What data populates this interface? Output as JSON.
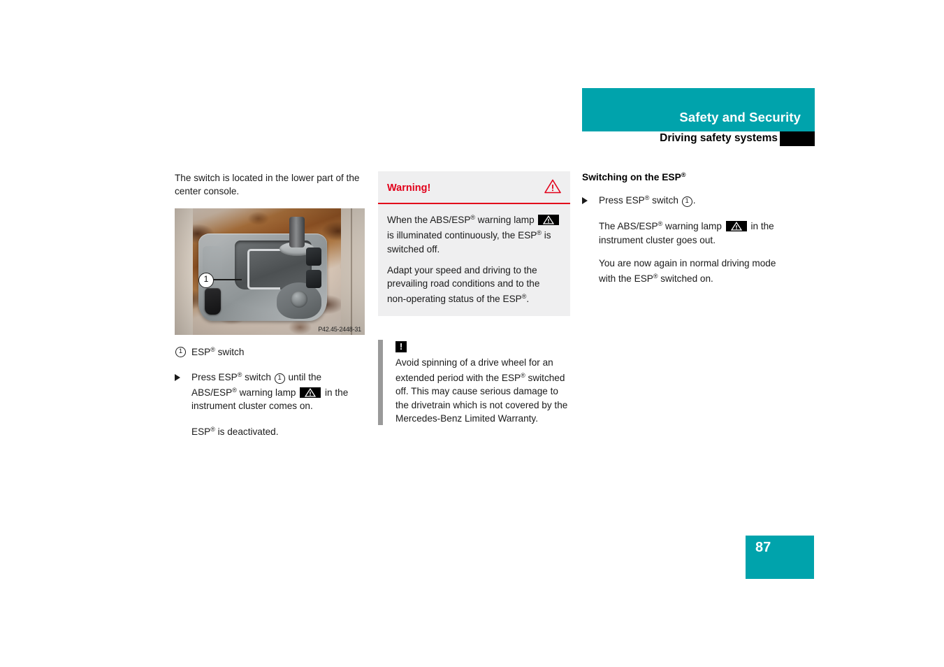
{
  "header": {
    "title": "Safety and Security",
    "subtitle": "Driving safety systems"
  },
  "left_column": {
    "intro": "The switch is located in the lower part of the center console.",
    "photo": {
      "alt": "Center console with automatic transmission selector lever and ESP switch",
      "code": "P42.45-2448-31",
      "callout": "1"
    },
    "legend": {
      "number": "1",
      "label_pre": "ESP",
      "label_post": " switch"
    },
    "step": {
      "marker": "bullet-arrow",
      "text_1": "Press ESP",
      "text_2": " switch ",
      "callout": "1",
      "text_3": " until the ABS/ESP",
      "text_4": " warning lamp ",
      "text_5": " in the instrument cluster comes on."
    },
    "result": {
      "text_1": "ESP",
      "text_2": " is deactivated."
    }
  },
  "warning_box": {
    "label": "Warning!",
    "icon": "warning-triangle-icon",
    "paragraph_1": {
      "text_1": "When the ABS/ESP",
      "text_2": " warning lamp ",
      "text_3": " is illuminated continuously, the ESP",
      "text_4": " is switched off."
    },
    "paragraph_2": {
      "text_1": "Adapt your speed and driving to the prevailing road conditions and to the non-operating status of the ESP",
      "text_2": "."
    }
  },
  "note_box": {
    "icon": "exclamation-note-icon",
    "text_1": "Avoid spinning of a drive wheel for an extended period with the ESP",
    "text_2": " switched off. This may cause serious damage to the drivetrain which is not covered by the Mercedes-Benz Limited Warranty."
  },
  "right_column": {
    "heading_1": "Switching on the ESP",
    "step": {
      "marker": "bullet-arrow",
      "text_1": "Press ESP",
      "text_2": " switch ",
      "callout": "1",
      "text_3": "."
    },
    "result_1": {
      "text_1": "The ABS/ESP",
      "text_2": " warning lamp ",
      "text_3": " in the instrument cluster goes out."
    },
    "result_2": {
      "text_1": "You are now again in normal driving mode with the ESP",
      "text_2": " switched on."
    }
  },
  "footer": {
    "page_number": "87"
  },
  "colors": {
    "accent_teal": "#00a3ac",
    "warning_red": "#e2001a",
    "warning_bg": "#efeff0",
    "note_bar": "#9a9a9a",
    "text": "#1a1a1a"
  }
}
